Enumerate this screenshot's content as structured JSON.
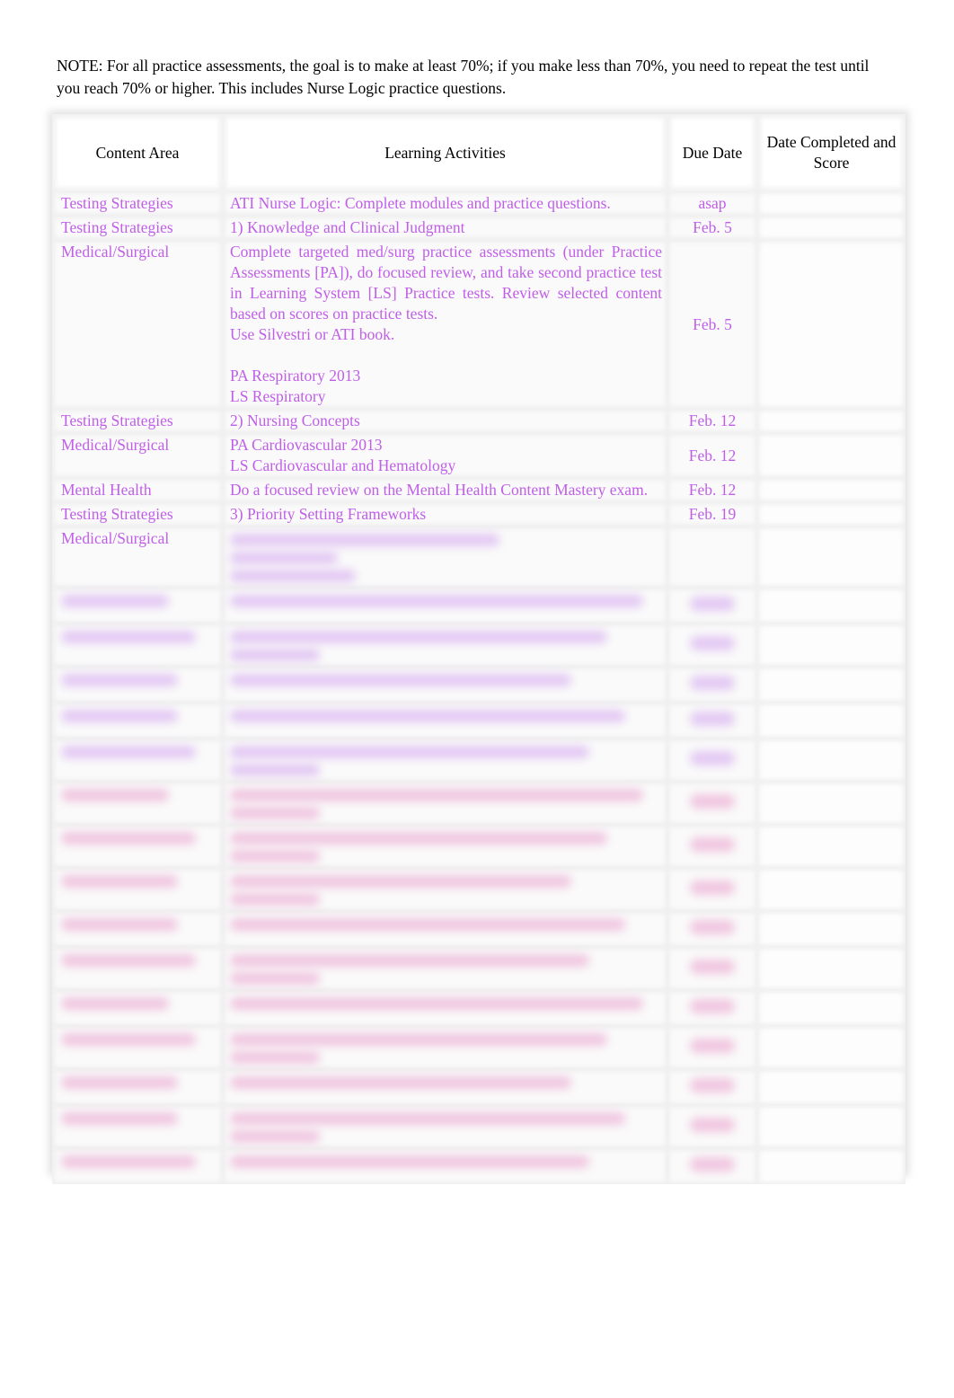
{
  "note": "NOTE: For all practice assessments, the goal is to make at least 70%; if you make less than 70%, you need to repeat the test until you reach 70% or higher. This includes Nurse Logic practice questions.",
  "table": {
    "headers": [
      "Content Area",
      "Learning Activities",
      "Due Date",
      "Date Completed and Score"
    ],
    "rows": [
      {
        "content_area": "Testing Strategies",
        "activities": [
          "ATI Nurse Logic: Complete modules and practice questions."
        ],
        "due": "asap",
        "score": ""
      },
      {
        "content_area": "Testing Strategies",
        "activities": [
          "1) Knowledge and Clinical Judgment"
        ],
        "due": "Feb. 5",
        "score": ""
      },
      {
        "content_area": "Medical/Surgical",
        "activities": [
          "Complete targeted med/surg practice assessments (under Practice Assessments [PA]), do focused review, and take second practice test in Learning System [LS] Practice tests. Review selected content based on scores on practice tests.",
          "Use Silvestri or ATI book.",
          "",
          "PA Respiratory 2013",
          "LS Respiratory"
        ],
        "due": "Feb. 5",
        "score": ""
      },
      {
        "content_area": "Testing Strategies",
        "activities": [
          "2) Nursing Concepts"
        ],
        "due": "Feb. 12",
        "score": ""
      },
      {
        "content_area": "Medical/Surgical",
        "activities": [
          "PA Cardiovascular 2013",
          "LS Cardiovascular and Hematology"
        ],
        "due": "Feb. 12",
        "score": ""
      },
      {
        "content_area": "Mental Health",
        "activities": [
          "Do a focused review on the Mental Health Content Mastery exam."
        ],
        "due": "Feb. 12",
        "score": ""
      },
      {
        "content_area": "Testing Strategies",
        "activities": [
          "3) Priority Setting Frameworks"
        ],
        "due": "Feb. 19",
        "score": ""
      },
      {
        "content_area": "Medical/Surgical",
        "activities": [],
        "due": "",
        "score": "",
        "obscured": true
      }
    ],
    "obscured_rows": [
      {
        "tint": "violet",
        "lines": 1
      },
      {
        "tint": "violet",
        "lines": 2
      },
      {
        "tint": "violet",
        "lines": 1
      },
      {
        "tint": "violet",
        "lines": 1
      },
      {
        "tint": "violet",
        "lines": 2
      },
      {
        "tint": "pink",
        "lines": 2
      },
      {
        "tint": "pink",
        "lines": 2
      },
      {
        "tint": "pink",
        "lines": 2
      },
      {
        "tint": "pink",
        "lines": 1
      },
      {
        "tint": "pink",
        "lines": 2
      },
      {
        "tint": "pink",
        "lines": 1
      },
      {
        "tint": "pink",
        "lines": 2
      },
      {
        "tint": "pink",
        "lines": 1
      },
      {
        "tint": "pink",
        "lines": 2
      },
      {
        "tint": "pink",
        "lines": 1
      }
    ]
  },
  "colors": {
    "activity_text": "#c05ee8",
    "obscured_violet": "#e3c8f3",
    "obscured_pink": "#f0c6e0"
  }
}
